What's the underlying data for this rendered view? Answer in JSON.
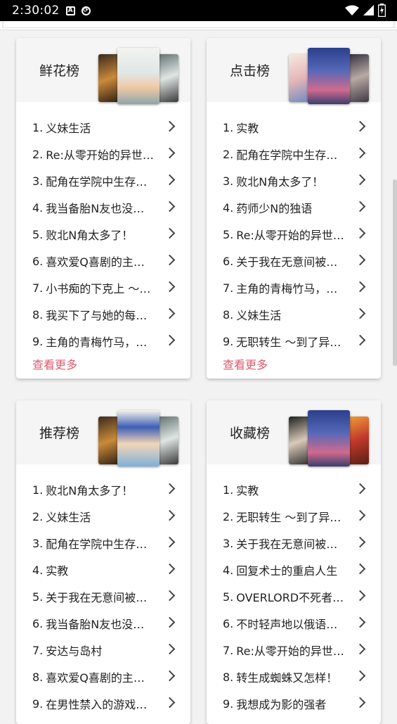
{
  "status": {
    "time": "2:30:02"
  },
  "colors": {
    "accent": "#e05a6d"
  },
  "cards": [
    {
      "title": "鲜花榜",
      "more": "查看更多",
      "items": [
        {
          "n": "1.",
          "t": "义妹生活"
        },
        {
          "n": "2.",
          "t": "Re:从零开始的异世…"
        },
        {
          "n": "3.",
          "t": "配角在学院中生存…"
        },
        {
          "n": "4.",
          "t": "我当备胎N友也没…"
        },
        {
          "n": "5.",
          "t": "败北N角太多了！"
        },
        {
          "n": "6.",
          "t": "喜欢爱Q喜剧的主…"
        },
        {
          "n": "7.",
          "t": "小书痴的下克上 ～…"
        },
        {
          "n": "8.",
          "t": "我买下了与她的每…"
        },
        {
          "n": "9.",
          "t": "主角的青梅竹马，…"
        }
      ]
    },
    {
      "title": "点击榜",
      "more": "查看更多",
      "items": [
        {
          "n": "1.",
          "t": "实教"
        },
        {
          "n": "2.",
          "t": "配角在学院中生存…"
        },
        {
          "n": "3.",
          "t": "败北N角太多了！"
        },
        {
          "n": "4.",
          "t": "药师少N的独语"
        },
        {
          "n": "5.",
          "t": "Re:从零开始的异世…"
        },
        {
          "n": "6.",
          "t": "关于我在无意间被…"
        },
        {
          "n": "7.",
          "t": "主角的青梅竹马，…"
        },
        {
          "n": "8.",
          "t": "义妹生活"
        },
        {
          "n": "9.",
          "t": "无职转生 ～到了异…"
        }
      ]
    },
    {
      "title": "推荐榜",
      "items": [
        {
          "n": "1.",
          "t": "败北N角太多了！"
        },
        {
          "n": "2.",
          "t": "义妹生活"
        },
        {
          "n": "3.",
          "t": "配角在学院中生存…"
        },
        {
          "n": "4.",
          "t": "实教"
        },
        {
          "n": "5.",
          "t": "关于我在无意间被…"
        },
        {
          "n": "6.",
          "t": "我当备胎N友也没…"
        },
        {
          "n": "7.",
          "t": "安达与岛村"
        },
        {
          "n": "8.",
          "t": "喜欢爱Q喜剧的主…"
        },
        {
          "n": "9.",
          "t": "在男性禁入的游戏…"
        }
      ]
    },
    {
      "title": "收藏榜",
      "items": [
        {
          "n": "1.",
          "t": "实教"
        },
        {
          "n": "2.",
          "t": "无职转生 ～到了异…"
        },
        {
          "n": "3.",
          "t": "关于我在无意间被…"
        },
        {
          "n": "4.",
          "t": "回复术士的重启人生"
        },
        {
          "n": "5.",
          "t": "OVERLORD不死者…"
        },
        {
          "n": "6.",
          "t": "不时轻声地以俄语…"
        },
        {
          "n": "7.",
          "t": "Re:从零开始的异世…"
        },
        {
          "n": "8.",
          "t": "转生成蜘蛛又怎样！"
        },
        {
          "n": "9.",
          "t": "我想成为影的强者"
        }
      ]
    }
  ]
}
